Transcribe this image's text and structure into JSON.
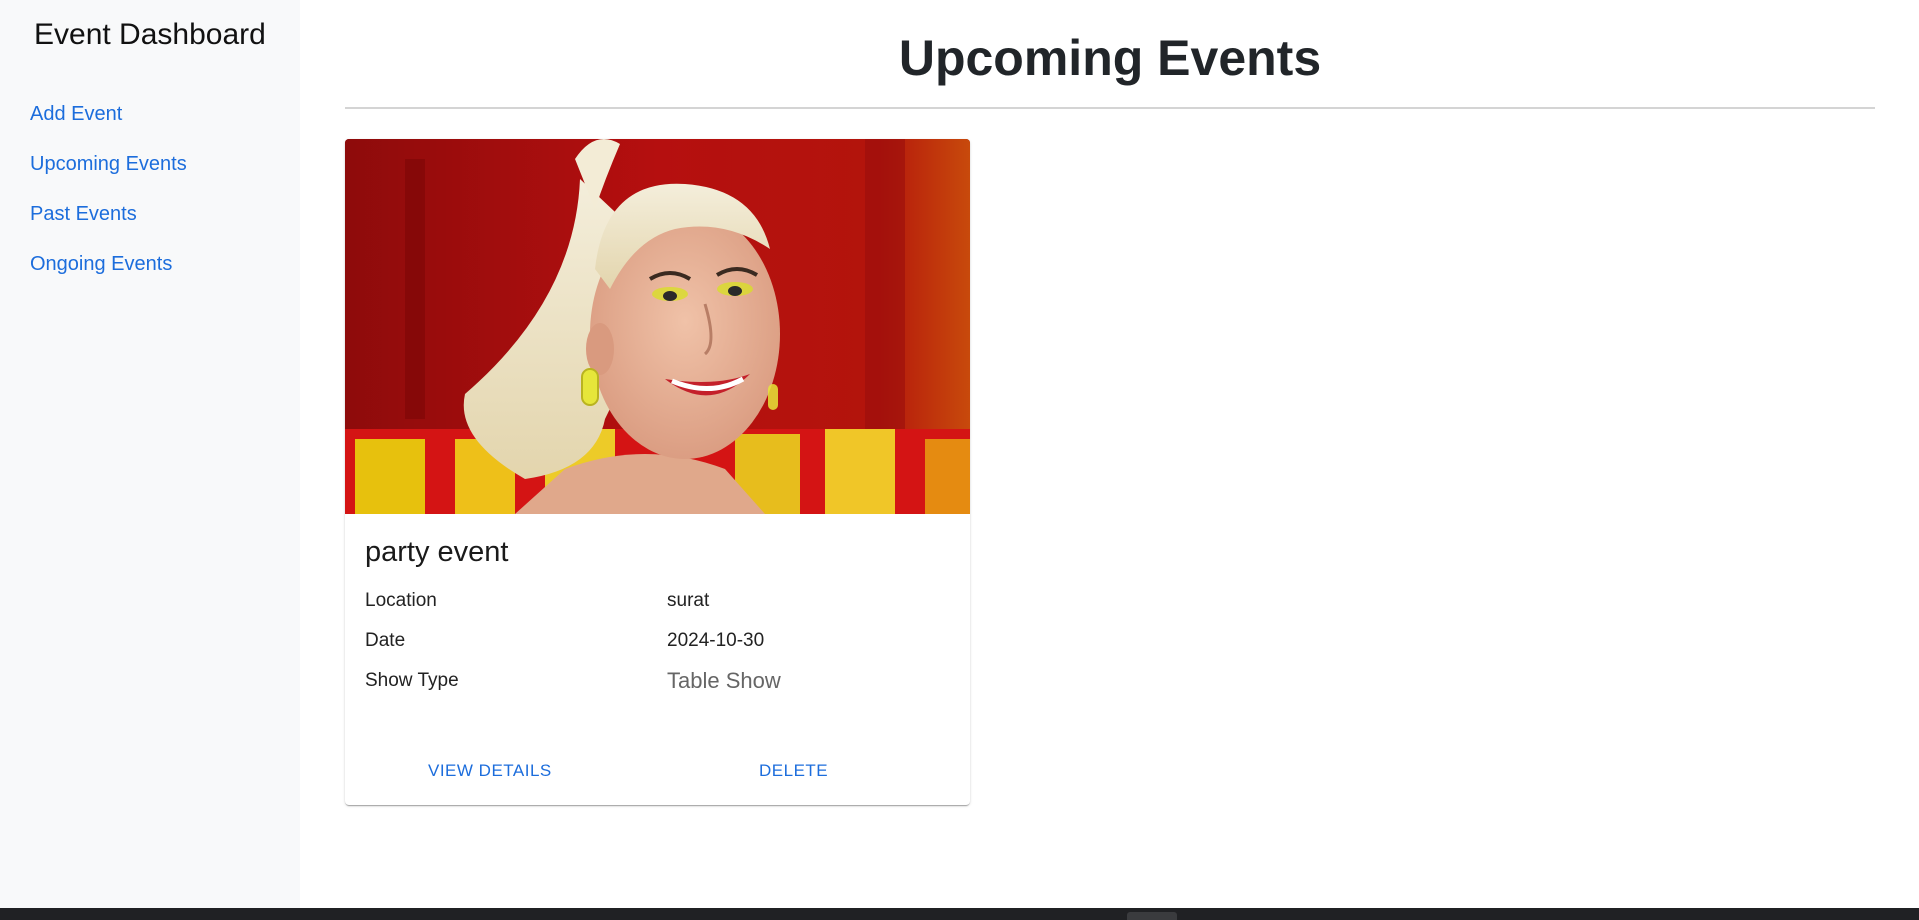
{
  "sidebar": {
    "title": "Event Dashboard",
    "items": [
      {
        "label": "Add Event"
      },
      {
        "label": "Upcoming Events"
      },
      {
        "label": "Past Events"
      },
      {
        "label": "Ongoing Events"
      }
    ]
  },
  "main": {
    "title": "Upcoming Events"
  },
  "event_card": {
    "image_icon": "event-photo",
    "title": "party event",
    "fields": [
      {
        "label": "Location",
        "value": "surat"
      },
      {
        "label": "Date",
        "value": "2024-10-30"
      },
      {
        "label": "Show Type",
        "value": "Table Show"
      }
    ],
    "actions": {
      "view_details": "VIEW DETAILS",
      "delete": "DELETE"
    }
  },
  "colors": {
    "link": "#1c6ddc",
    "sidebar_bg": "#f8f9fa",
    "taskbar": "#202124"
  }
}
